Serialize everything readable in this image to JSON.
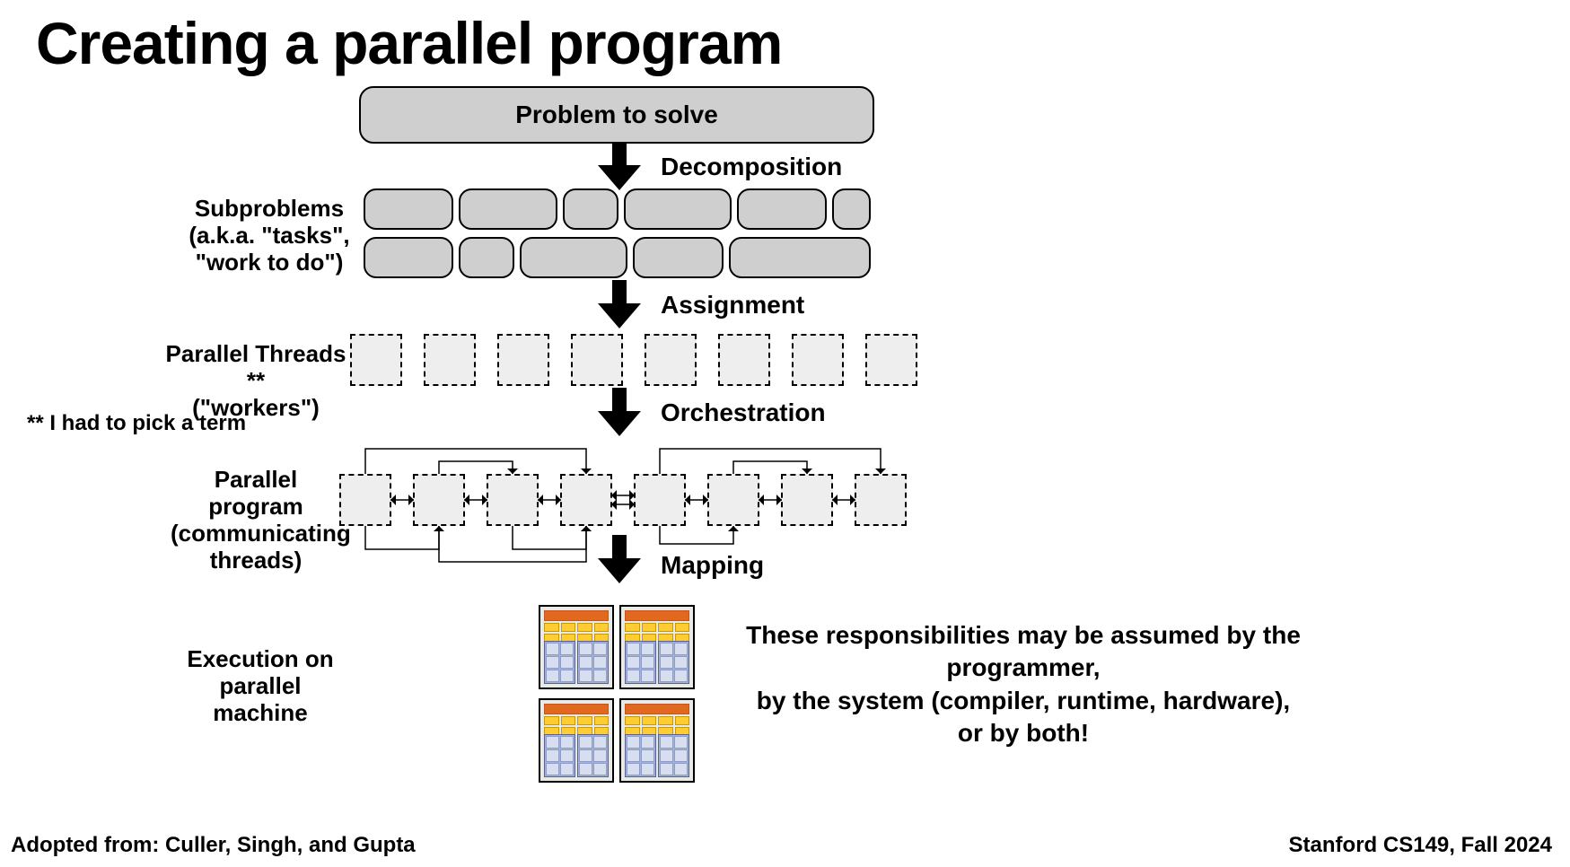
{
  "title": "Creating a parallel program",
  "boxes": {
    "problem": "Problem to solve"
  },
  "stage_labels": {
    "decomposition": "Decomposition",
    "assignment": "Assignment",
    "orchestration": "Orchestration",
    "mapping": "Mapping"
  },
  "left_labels": {
    "subproblems": "Subproblems\n(a.k.a. \"tasks\",\n\"work to do\")",
    "threads": "Parallel Threads **\n(\"workers\")",
    "program": "Parallel program\n(communicating\nthreads)",
    "execution": "Execution on\nparallel machine"
  },
  "footnote": "** I had to pick a term",
  "responsibility": "These responsibilities may be assumed by the programmer,\nby the system (compiler, runtime, hardware), or by both!",
  "credits": {
    "left": "Adopted from: Culler, Singh, and Gupta",
    "right": "Stanford CS149, Fall 2024"
  },
  "tasks_row1_widths": [
    100,
    110,
    60,
    120,
    100,
    40
  ],
  "tasks_row2_widths": [
    100,
    60,
    120,
    100,
    160
  ],
  "worker_count": 8,
  "comm_count": 8
}
